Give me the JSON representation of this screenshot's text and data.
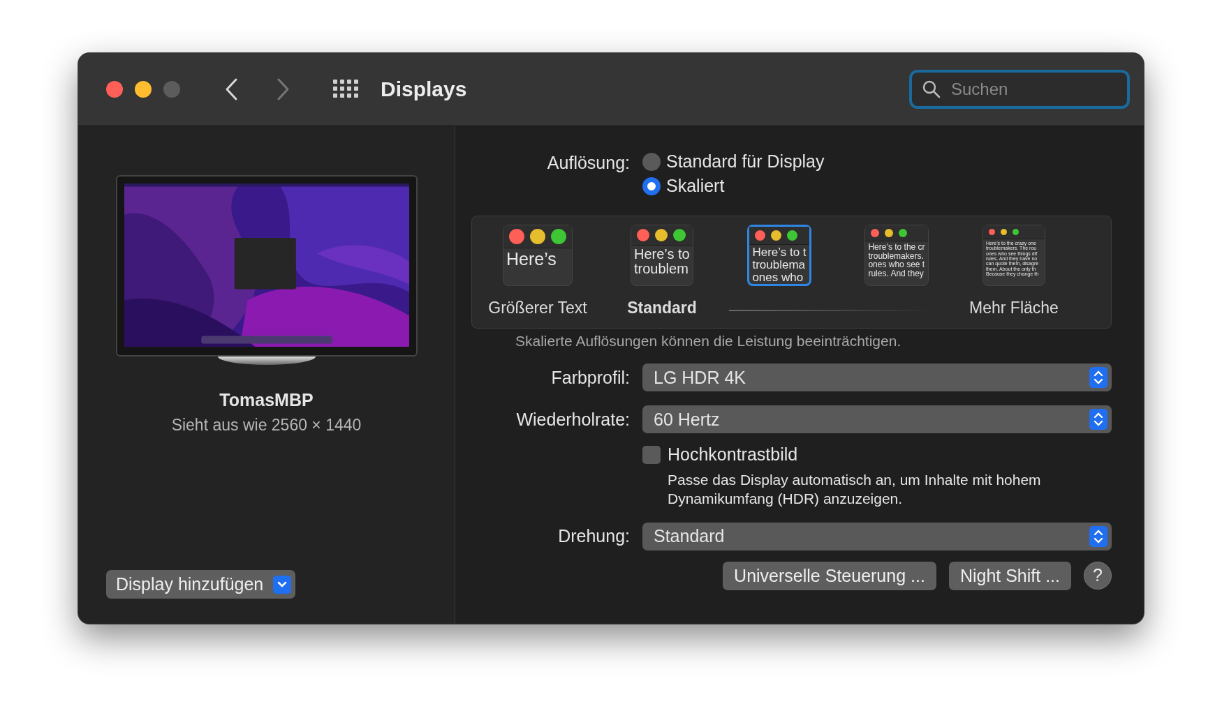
{
  "window": {
    "title": "Displays"
  },
  "search": {
    "placeholder": "Suchen"
  },
  "display": {
    "name": "TomasMBP",
    "subtitle": "Sieht aus wie 2560 × 1440"
  },
  "add_display_button": {
    "label": "Display hinzufügen"
  },
  "resolution": {
    "label": "Auflösung:",
    "options": [
      {
        "label": "Standard für Display",
        "selected": false
      },
      {
        "label": "Skaliert",
        "selected": true
      }
    ]
  },
  "scaling": {
    "options": [
      {
        "kind": "xl",
        "lines": [
          "Here’s"
        ],
        "label": "Größerer Text",
        "default": false,
        "selected": false
      },
      {
        "kind": "l",
        "lines": [
          "Here’s to",
          "troublem"
        ],
        "label": "Standard",
        "default": true,
        "selected": false
      },
      {
        "kind": "m",
        "lines": [
          "Here’s to t",
          "troublema",
          "ones who"
        ],
        "selected": true
      },
      {
        "kind": "s",
        "lines": [
          "Here’s to the cr",
          "troublemakers.",
          "ones who see t",
          "rules. And they"
        ],
        "selected": false
      },
      {
        "kind": "xs",
        "lines": [
          "Here’s to the crazy one",
          "troublemakers. The rou",
          "ones who see things dif",
          "rules. And they have no",
          "can quote them, disagre",
          "them. About the only th",
          "Because they change th"
        ],
        "label": "Mehr Fläche",
        "default": false,
        "selected": false
      }
    ],
    "note": "Skalierte Auflösungen können die Leistung beeinträchtigen."
  },
  "color_profile": {
    "label": "Farbprofil:",
    "value": "LG HDR 4K"
  },
  "refresh_rate": {
    "label": "Wiederholrate:",
    "value": "60 Hertz"
  },
  "high_contrast": {
    "label": "Hochkontrastbild",
    "checked": false,
    "description": "Passe das Display automatisch an, um Inhalte mit hohem Dynamikumfang (HDR) anzuzeigen."
  },
  "rotation": {
    "label": "Drehung:",
    "value": "Standard"
  },
  "buttons": [
    {
      "kind": "text",
      "label": "Universelle Steuerung ..."
    },
    {
      "kind": "text",
      "label": "Night Shift ..."
    },
    {
      "kind": "help",
      "label": "?"
    }
  ]
}
